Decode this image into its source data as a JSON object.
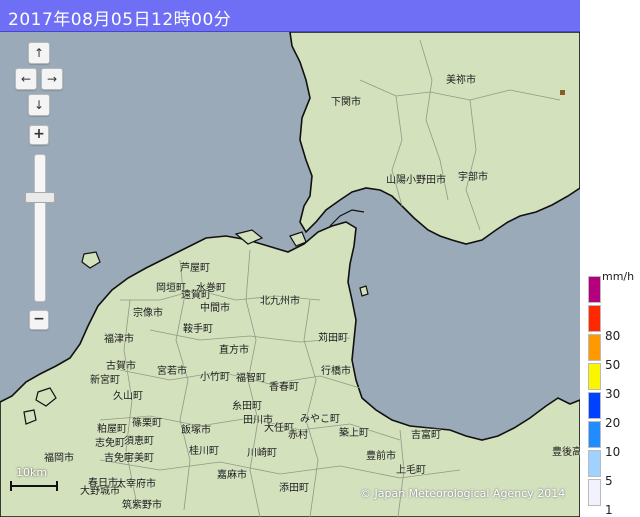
{
  "header": {
    "timestamp": "2017年08月05日12時00分"
  },
  "controls": {
    "pan_up": "↑",
    "pan_left": "←",
    "pan_right": "→",
    "pan_down": "↓",
    "zoom_in": "+",
    "zoom_out": "−",
    "zoom_level_fraction": 0.28
  },
  "map": {
    "colors": {
      "sea": "#9aaab8",
      "land": "#d3e1bd",
      "coast": "#111111",
      "boundary": "#8f9a86"
    },
    "cities": [
      {
        "name": "美祢市"
      },
      {
        "name": "下関市"
      },
      {
        "name": "山陽小野田市"
      },
      {
        "name": "宇部市"
      },
      {
        "name": "芦屋町"
      },
      {
        "name": "岡垣町"
      },
      {
        "name": "遠賀町"
      },
      {
        "name": "水巻町"
      },
      {
        "name": "中間市"
      },
      {
        "name": "宗像市"
      },
      {
        "name": "北九州市"
      },
      {
        "name": "鞍手町"
      },
      {
        "name": "福津市"
      },
      {
        "name": "直方市"
      },
      {
        "name": "苅田町"
      },
      {
        "name": "古賀市"
      },
      {
        "name": "宮若市"
      },
      {
        "name": "新宮町"
      },
      {
        "name": "小竹町"
      },
      {
        "name": "福智町"
      },
      {
        "name": "行橋市"
      },
      {
        "name": "香春町"
      },
      {
        "name": "久山町"
      },
      {
        "name": "糸田町"
      },
      {
        "name": "篠栗町"
      },
      {
        "name": "田川市"
      },
      {
        "name": "飯塚市"
      },
      {
        "name": "大任町"
      },
      {
        "name": "みやこ町"
      },
      {
        "name": "粕屋町"
      },
      {
        "name": "赤村"
      },
      {
        "name": "築上町"
      },
      {
        "name": "吉富町"
      },
      {
        "name": "須恵町"
      },
      {
        "name": "志免町"
      },
      {
        "name": "吉免町"
      },
      {
        "name": "桂川町"
      },
      {
        "name": "川崎町"
      },
      {
        "name": "豊前市"
      },
      {
        "name": "宇美町"
      },
      {
        "name": "福岡市"
      },
      {
        "name": "上毛町"
      },
      {
        "name": "嘉麻市"
      },
      {
        "name": "添田町"
      },
      {
        "name": "大野城市"
      },
      {
        "name": "春日市"
      },
      {
        "name": "太宰府市"
      },
      {
        "name": "筑紫野市"
      },
      {
        "name": "豊後高"
      }
    ],
    "scale_label": "10km",
    "copyright": "© Japan Meteorological Agency 2014"
  },
  "legend": {
    "unit": "mm/h",
    "levels": [
      {
        "label": "",
        "color": "#b4007f"
      },
      {
        "label": "80",
        "color": "#ff2800"
      },
      {
        "label": "50",
        "color": "#ff9900"
      },
      {
        "label": "30",
        "color": "#faf500"
      },
      {
        "label": "20",
        "color": "#0041ff"
      },
      {
        "label": "10",
        "color": "#218cff"
      },
      {
        "label": "5",
        "color": "#a0d2ff"
      },
      {
        "label": "1",
        "color": "#f2f2ff"
      }
    ]
  }
}
